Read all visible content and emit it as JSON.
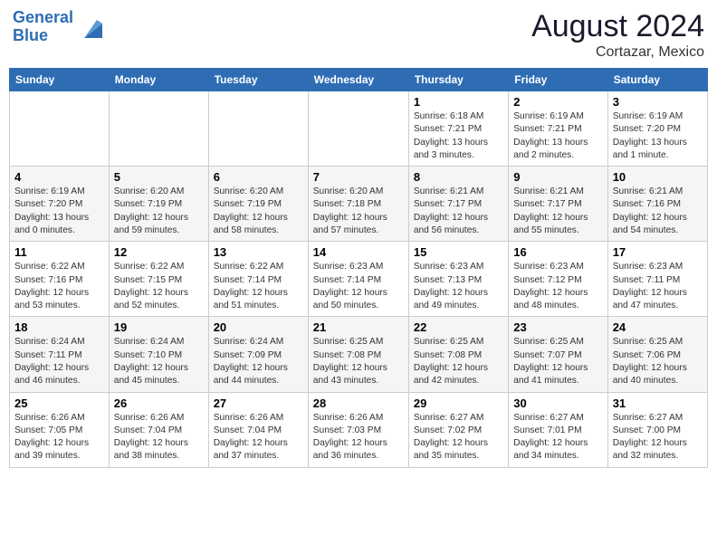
{
  "header": {
    "logo_line1": "General",
    "logo_line2": "Blue",
    "month_year": "August 2024",
    "location": "Cortazar, Mexico"
  },
  "days_of_week": [
    "Sunday",
    "Monday",
    "Tuesday",
    "Wednesday",
    "Thursday",
    "Friday",
    "Saturday"
  ],
  "weeks": [
    [
      {
        "day": "",
        "info": ""
      },
      {
        "day": "",
        "info": ""
      },
      {
        "day": "",
        "info": ""
      },
      {
        "day": "",
        "info": ""
      },
      {
        "day": "1",
        "info": "Sunrise: 6:18 AM\nSunset: 7:21 PM\nDaylight: 13 hours\nand 3 minutes."
      },
      {
        "day": "2",
        "info": "Sunrise: 6:19 AM\nSunset: 7:21 PM\nDaylight: 13 hours\nand 2 minutes."
      },
      {
        "day": "3",
        "info": "Sunrise: 6:19 AM\nSunset: 7:20 PM\nDaylight: 13 hours\nand 1 minute."
      }
    ],
    [
      {
        "day": "4",
        "info": "Sunrise: 6:19 AM\nSunset: 7:20 PM\nDaylight: 13 hours\nand 0 minutes."
      },
      {
        "day": "5",
        "info": "Sunrise: 6:20 AM\nSunset: 7:19 PM\nDaylight: 12 hours\nand 59 minutes."
      },
      {
        "day": "6",
        "info": "Sunrise: 6:20 AM\nSunset: 7:19 PM\nDaylight: 12 hours\nand 58 minutes."
      },
      {
        "day": "7",
        "info": "Sunrise: 6:20 AM\nSunset: 7:18 PM\nDaylight: 12 hours\nand 57 minutes."
      },
      {
        "day": "8",
        "info": "Sunrise: 6:21 AM\nSunset: 7:17 PM\nDaylight: 12 hours\nand 56 minutes."
      },
      {
        "day": "9",
        "info": "Sunrise: 6:21 AM\nSunset: 7:17 PM\nDaylight: 12 hours\nand 55 minutes."
      },
      {
        "day": "10",
        "info": "Sunrise: 6:21 AM\nSunset: 7:16 PM\nDaylight: 12 hours\nand 54 minutes."
      }
    ],
    [
      {
        "day": "11",
        "info": "Sunrise: 6:22 AM\nSunset: 7:16 PM\nDaylight: 12 hours\nand 53 minutes."
      },
      {
        "day": "12",
        "info": "Sunrise: 6:22 AM\nSunset: 7:15 PM\nDaylight: 12 hours\nand 52 minutes."
      },
      {
        "day": "13",
        "info": "Sunrise: 6:22 AM\nSunset: 7:14 PM\nDaylight: 12 hours\nand 51 minutes."
      },
      {
        "day": "14",
        "info": "Sunrise: 6:23 AM\nSunset: 7:14 PM\nDaylight: 12 hours\nand 50 minutes."
      },
      {
        "day": "15",
        "info": "Sunrise: 6:23 AM\nSunset: 7:13 PM\nDaylight: 12 hours\nand 49 minutes."
      },
      {
        "day": "16",
        "info": "Sunrise: 6:23 AM\nSunset: 7:12 PM\nDaylight: 12 hours\nand 48 minutes."
      },
      {
        "day": "17",
        "info": "Sunrise: 6:23 AM\nSunset: 7:11 PM\nDaylight: 12 hours\nand 47 minutes."
      }
    ],
    [
      {
        "day": "18",
        "info": "Sunrise: 6:24 AM\nSunset: 7:11 PM\nDaylight: 12 hours\nand 46 minutes."
      },
      {
        "day": "19",
        "info": "Sunrise: 6:24 AM\nSunset: 7:10 PM\nDaylight: 12 hours\nand 45 minutes."
      },
      {
        "day": "20",
        "info": "Sunrise: 6:24 AM\nSunset: 7:09 PM\nDaylight: 12 hours\nand 44 minutes."
      },
      {
        "day": "21",
        "info": "Sunrise: 6:25 AM\nSunset: 7:08 PM\nDaylight: 12 hours\nand 43 minutes."
      },
      {
        "day": "22",
        "info": "Sunrise: 6:25 AM\nSunset: 7:08 PM\nDaylight: 12 hours\nand 42 minutes."
      },
      {
        "day": "23",
        "info": "Sunrise: 6:25 AM\nSunset: 7:07 PM\nDaylight: 12 hours\nand 41 minutes."
      },
      {
        "day": "24",
        "info": "Sunrise: 6:25 AM\nSunset: 7:06 PM\nDaylight: 12 hours\nand 40 minutes."
      }
    ],
    [
      {
        "day": "25",
        "info": "Sunrise: 6:26 AM\nSunset: 7:05 PM\nDaylight: 12 hours\nand 39 minutes."
      },
      {
        "day": "26",
        "info": "Sunrise: 6:26 AM\nSunset: 7:04 PM\nDaylight: 12 hours\nand 38 minutes."
      },
      {
        "day": "27",
        "info": "Sunrise: 6:26 AM\nSunset: 7:04 PM\nDaylight: 12 hours\nand 37 minutes."
      },
      {
        "day": "28",
        "info": "Sunrise: 6:26 AM\nSunset: 7:03 PM\nDaylight: 12 hours\nand 36 minutes."
      },
      {
        "day": "29",
        "info": "Sunrise: 6:27 AM\nSunset: 7:02 PM\nDaylight: 12 hours\nand 35 minutes."
      },
      {
        "day": "30",
        "info": "Sunrise: 6:27 AM\nSunset: 7:01 PM\nDaylight: 12 hours\nand 34 minutes."
      },
      {
        "day": "31",
        "info": "Sunrise: 6:27 AM\nSunset: 7:00 PM\nDaylight: 12 hours\nand 32 minutes."
      }
    ]
  ]
}
